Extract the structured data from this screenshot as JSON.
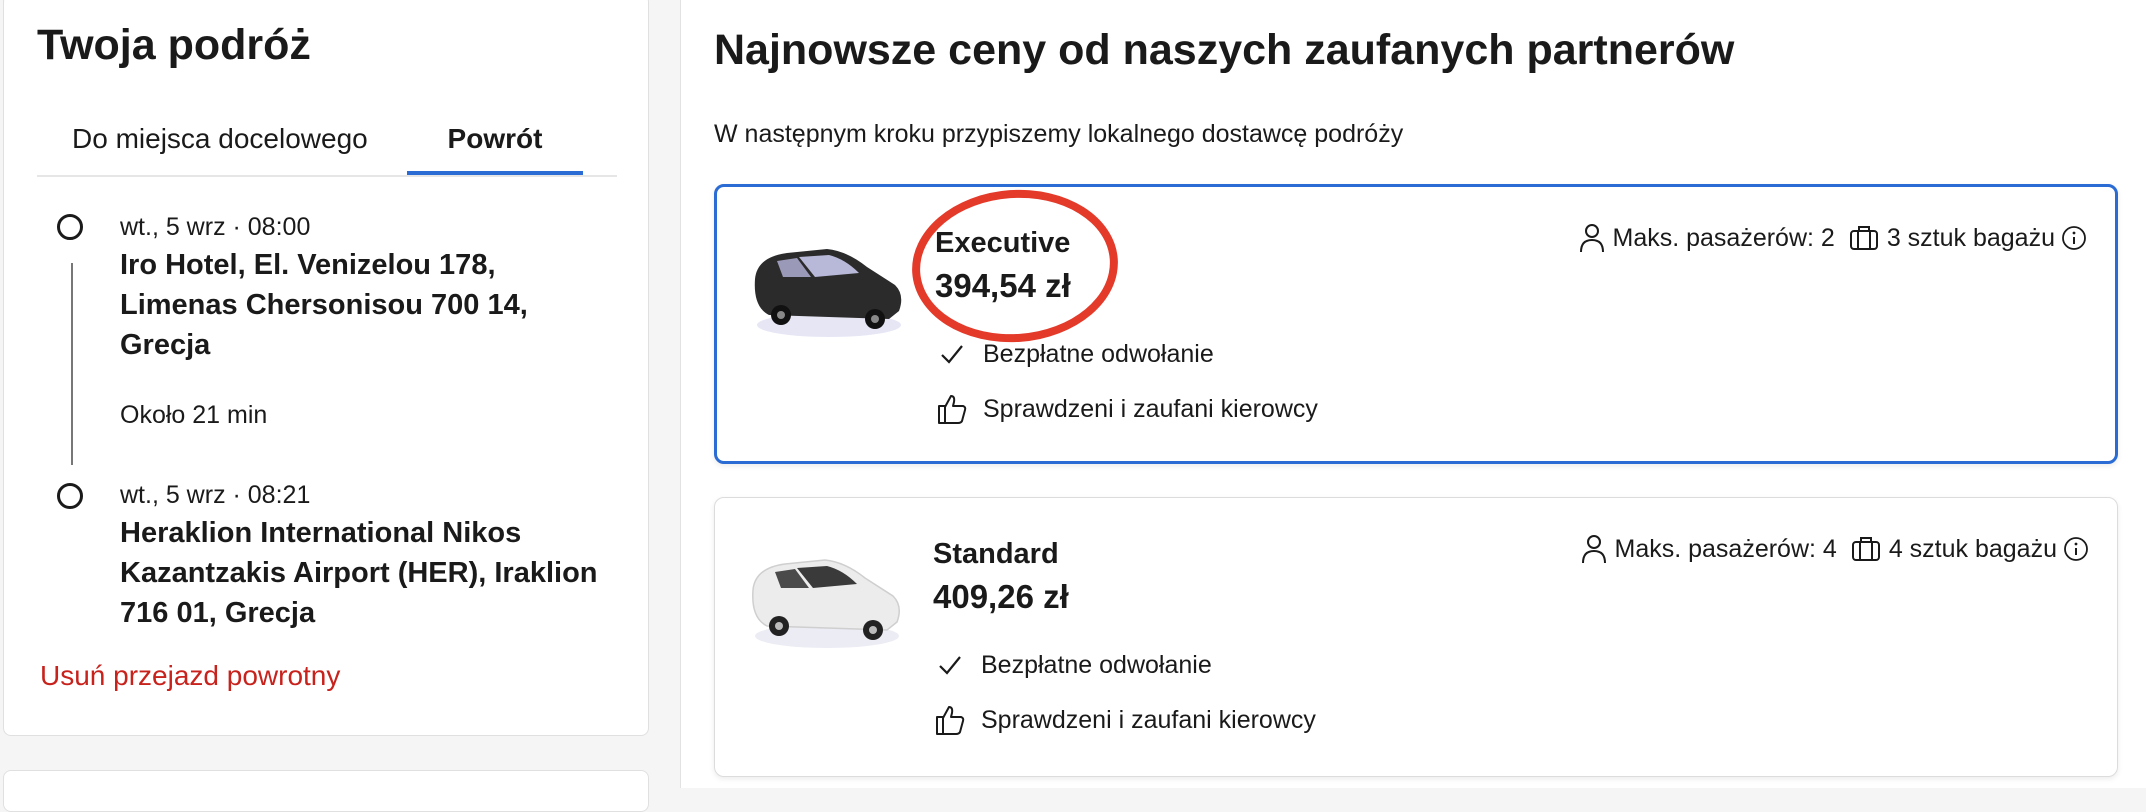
{
  "sidebar": {
    "title": "Twoja podróż",
    "tabs": [
      {
        "label": "Do miejsca docelowego",
        "active": false
      },
      {
        "label": "Powrót",
        "active": true
      }
    ],
    "stops": [
      {
        "time": "wt., 5 wrz · 08:00",
        "address": "Iro Hotel, El. Venizelou 178, Limenas Chersonisou 700 14, Grecja"
      },
      {
        "time": "wt., 5 wrz · 08:21",
        "address": "Heraklion International Nikos Kazantzakis Airport (HER), Iraklion 716 01, Grecja"
      }
    ],
    "duration": "Około 21 min",
    "remove_link": "Usuń przejazd powrotny"
  },
  "main": {
    "title": "Najnowsze ceny od naszych zaufanych partnerów",
    "subtitle": "W następnym kroku przypiszemy lokalnego dostawcę podróży",
    "cards": [
      {
        "name": "Executive",
        "price": "394,54 zł",
        "passengers": "Maks. pasażerów: 2",
        "luggage": "3 sztuk bagażu",
        "feature_cancel": "Bezpłatne odwołanie",
        "feature_drivers": "Sprawdzeni i zaufani kierowcy",
        "car_color": "#2b2b2b",
        "selected": true
      },
      {
        "name": "Standard",
        "price": "409,26 zł",
        "passengers": "Maks. pasażerów: 4",
        "luggage": "4 sztuk bagażu",
        "feature_cancel": "Bezpłatne odwołanie",
        "feature_drivers": "Sprawdzeni i zaufani kierowcy",
        "car_color": "#e8e8e8",
        "selected": false
      }
    ]
  },
  "colors": {
    "accent": "#2a6bd4",
    "danger": "#c8221d",
    "annotation": "#e33a2a"
  },
  "icons": [
    "person-icon",
    "luggage-icon",
    "info-icon",
    "check-icon",
    "thumbs-up-icon",
    "car-icon"
  ]
}
